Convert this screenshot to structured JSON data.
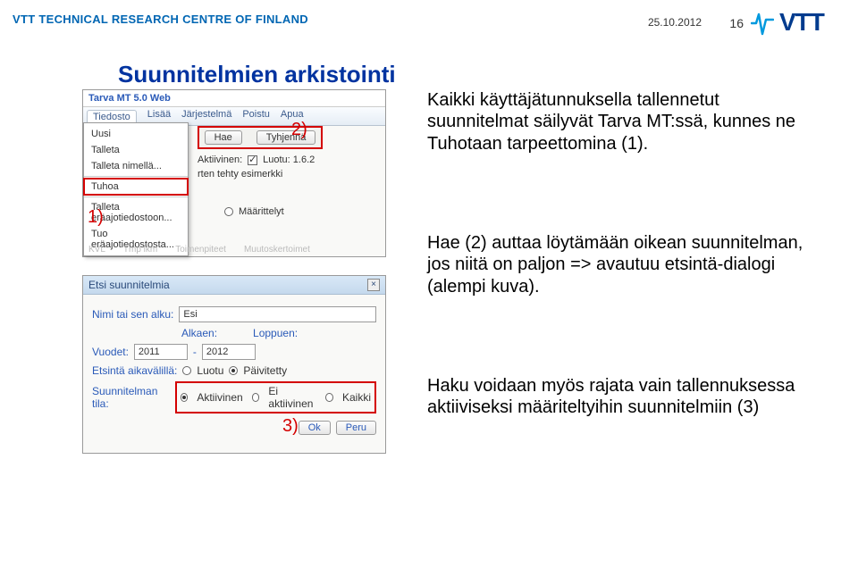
{
  "header": {
    "org": "VTT TECHNICAL RESEARCH CENTRE OF FINLAND",
    "date": "25.10.2012",
    "page": "16",
    "logo_text": "VTT"
  },
  "title": "Suunnitelmien arkistointi",
  "callouts": {
    "c1": "1)",
    "c2": "2)",
    "c3": "3)"
  },
  "shot_top": {
    "app_title": "Tarva MT 5.0 Web",
    "menu": {
      "tiedosto": "Tiedosto",
      "lisaa": "Lisää",
      "jarjestelma": "Järjestelmä",
      "poistu": "Poistu",
      "apua": "Apua"
    },
    "file_items": {
      "uusi": "Uusi",
      "talleta": "Talleta",
      "talleta_nimella": "Talleta nimellä...",
      "tuhoa": "Tuhoa",
      "talleta_eraajo": "Talleta eräajotiedostoon...",
      "tuo_eraajo": "Tuo eräajotiedostosta..."
    },
    "right": {
      "hae": "Hae",
      "tyhjenna": "Tyhjennä",
      "aktiivinen": "Aktiivinen:",
      "luotu": "Luotu: 1.6.2",
      "esimerkki": "rten tehty esimerkki",
      "maarittelyt": "Määrittelyt"
    },
    "faint": {
      "kvl": "KVL",
      "tmp": "Tmp lkm",
      "toimenpiteet": "Toimenpiteet",
      "muutos": "Muutoskertoimet"
    }
  },
  "shot_bottom": {
    "dlg_title": "Etsi suunnitelmia",
    "name_label": "Nimi tai sen alku:",
    "name_value": "Esi",
    "alkaen": "Alkaen:",
    "loppuen": "Loppuen:",
    "vuodet": "Vuodet:",
    "year_from": "2011",
    "year_to": "2012",
    "span_dash": "-",
    "aikavali": "Etsintä aikavälillä:",
    "luotu": "Luotu",
    "paivitetty": "Päivitetty",
    "tila": "Suunnitelman tila:",
    "aktiivinen": "Aktiivinen",
    "ei_aktiivinen": "Ei aktiivinen",
    "kaikki": "Kaikki",
    "ok": "Ok",
    "peru": "Peru"
  },
  "paragraphs": {
    "p1": "Kaikki käyttäjätunnuksella tallennetut suunnitelmat säilyvät Tarva MT:ssä, kunnes ne Tuhotaan tarpeettomina (1).",
    "p2": "Hae (2) auttaa löytämään oikean suunnitelman, jos niitä on paljon => avautuu etsintä-dialogi (alempi kuva).",
    "p3": "Haku voidaan myös rajata vain tallennuksessa aktiiviseksi määriteltyihin suunnitelmiin (3)"
  }
}
